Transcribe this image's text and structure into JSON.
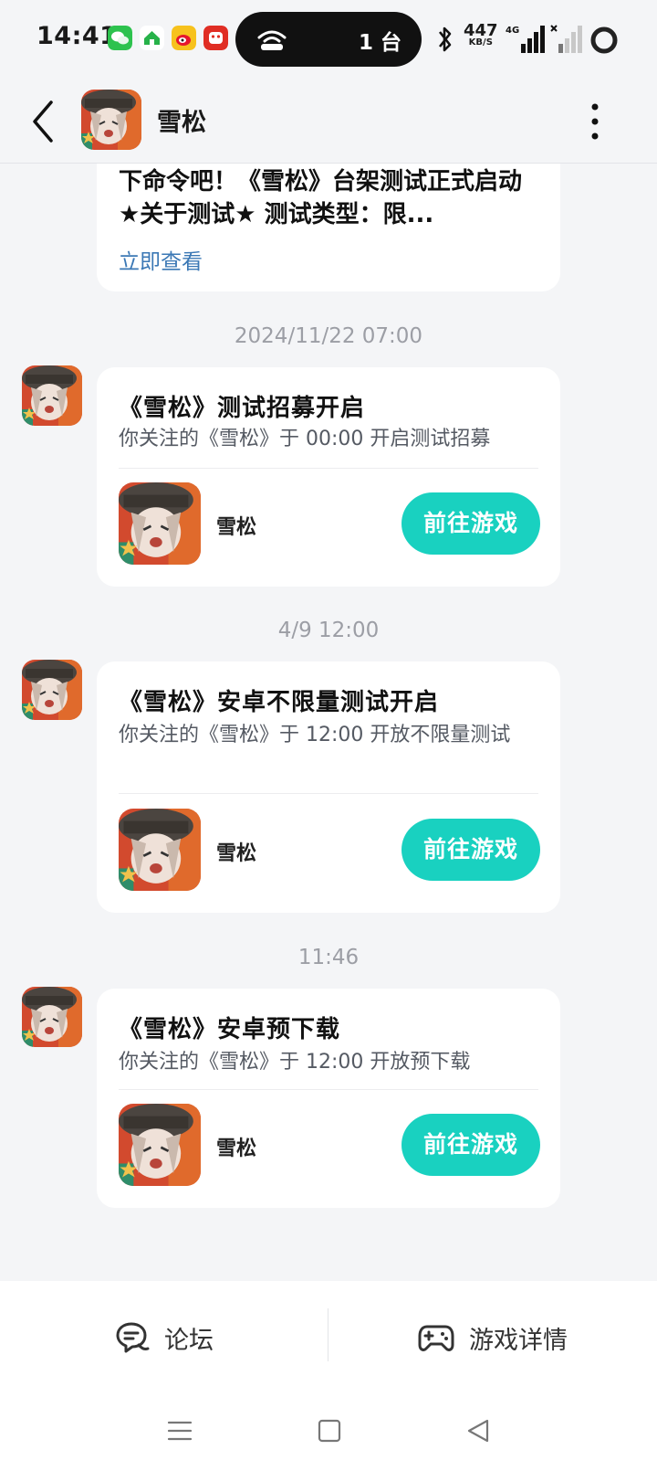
{
  "status_bar": {
    "time": "14:41",
    "pill_text": "1 台",
    "net_speed_value": "447",
    "net_speed_unit": "KB/S",
    "network_type": "4G",
    "app_icons": [
      "wechat-icon",
      "anjuke-icon",
      "weibo-icon",
      "pdd-icon"
    ],
    "icons": [
      "hotspot-icon",
      "bluetooth-icon",
      "signal-icon",
      "signal-weak-icon",
      "battery-icon"
    ]
  },
  "header": {
    "title": "雪松",
    "back_icon": "back-arrow-icon",
    "more_icon": "more-vertical-icon"
  },
  "top_card": {
    "text": "下命令吧！《雪松》台架测试正式启动 ★关于测试★ 测试类型：限...",
    "link": "立即查看"
  },
  "messages": [
    {
      "timestamp": "2024/11/22  07:00",
      "title": "《雪松》测试招募开启",
      "desc": "你关注的《雪松》于 00:00 开启测试招募",
      "game_name": "雪松",
      "button": "前往游戏"
    },
    {
      "timestamp": "4/9  12:00",
      "title": "《雪松》安卓不限量测试开启",
      "desc": "你关注的《雪松》于 12:00 开放不限量测试",
      "game_name": "雪松",
      "button": "前往游戏"
    },
    {
      "timestamp": "11:46",
      "title": "《雪松》安卓预下载",
      "desc": "你关注的《雪松》于 12:00 开放预下载",
      "game_name": "雪松",
      "button": "前往游戏"
    }
  ],
  "bottom_bar": {
    "forum_label": "论坛",
    "forum_icon": "chat-bubble-icon",
    "details_label": "游戏详情",
    "details_icon": "gamepad-icon"
  },
  "nav": {
    "icons": [
      "menu-icon",
      "home-square-icon",
      "back-triangle-icon"
    ]
  },
  "colors": {
    "accent": "#19d1c0",
    "link": "#3b78b5",
    "background": "#f4f5f7"
  }
}
